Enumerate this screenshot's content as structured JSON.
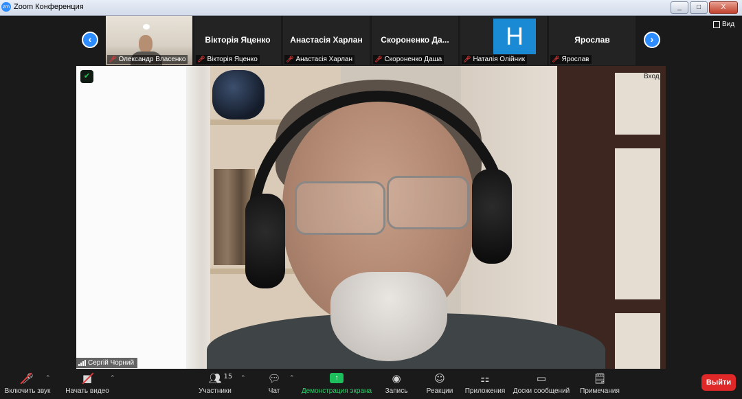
{
  "window": {
    "title": "Zoom Конференция",
    "app_icon": "zm",
    "controls": [
      "_",
      "□",
      "X"
    ]
  },
  "header": {
    "view_label": "Вид"
  },
  "gallery": {
    "participants": [
      {
        "display": "video",
        "label": "Олександр Власенко"
      },
      {
        "display": "name",
        "name": "Вікторія Яценко",
        "label": "Вікторія Яценко"
      },
      {
        "display": "name",
        "name": "Анастасія Харлан",
        "label": "Анастасія Харлан"
      },
      {
        "display": "name",
        "name": "Скороненко  Да...",
        "label": "Скороненко Даша"
      },
      {
        "display": "avatar",
        "initial": "H",
        "label": "Наталія Олійник",
        "avatar_color": "#1a8ad4"
      },
      {
        "display": "name",
        "name": "Ярослав",
        "label": "Ярослав"
      }
    ],
    "prev_icon": "chevron-left-icon",
    "next_icon": "chevron-right-icon"
  },
  "main_video": {
    "speaker_name": "Сергій Чорний",
    "enter_label": "Вход"
  },
  "toolbar": {
    "unmute_label": "Включить звук",
    "start_video_label": "Начать видео",
    "participants_label": "Участники",
    "participants_count": "15",
    "chat_label": "Чат",
    "share_label": "Демонстрация экрана",
    "record_label": "Запись",
    "reactions_label": "Реакции",
    "apps_label": "Приложения",
    "whiteboards_label": "Доски сообщений",
    "notes_label": "Примечания",
    "leave_label": "Выйти"
  },
  "colors": {
    "accent": "#2d8cff",
    "share_green": "#1dbf5c",
    "leave_red": "#e02828",
    "muted_red": "#e03a3a"
  }
}
